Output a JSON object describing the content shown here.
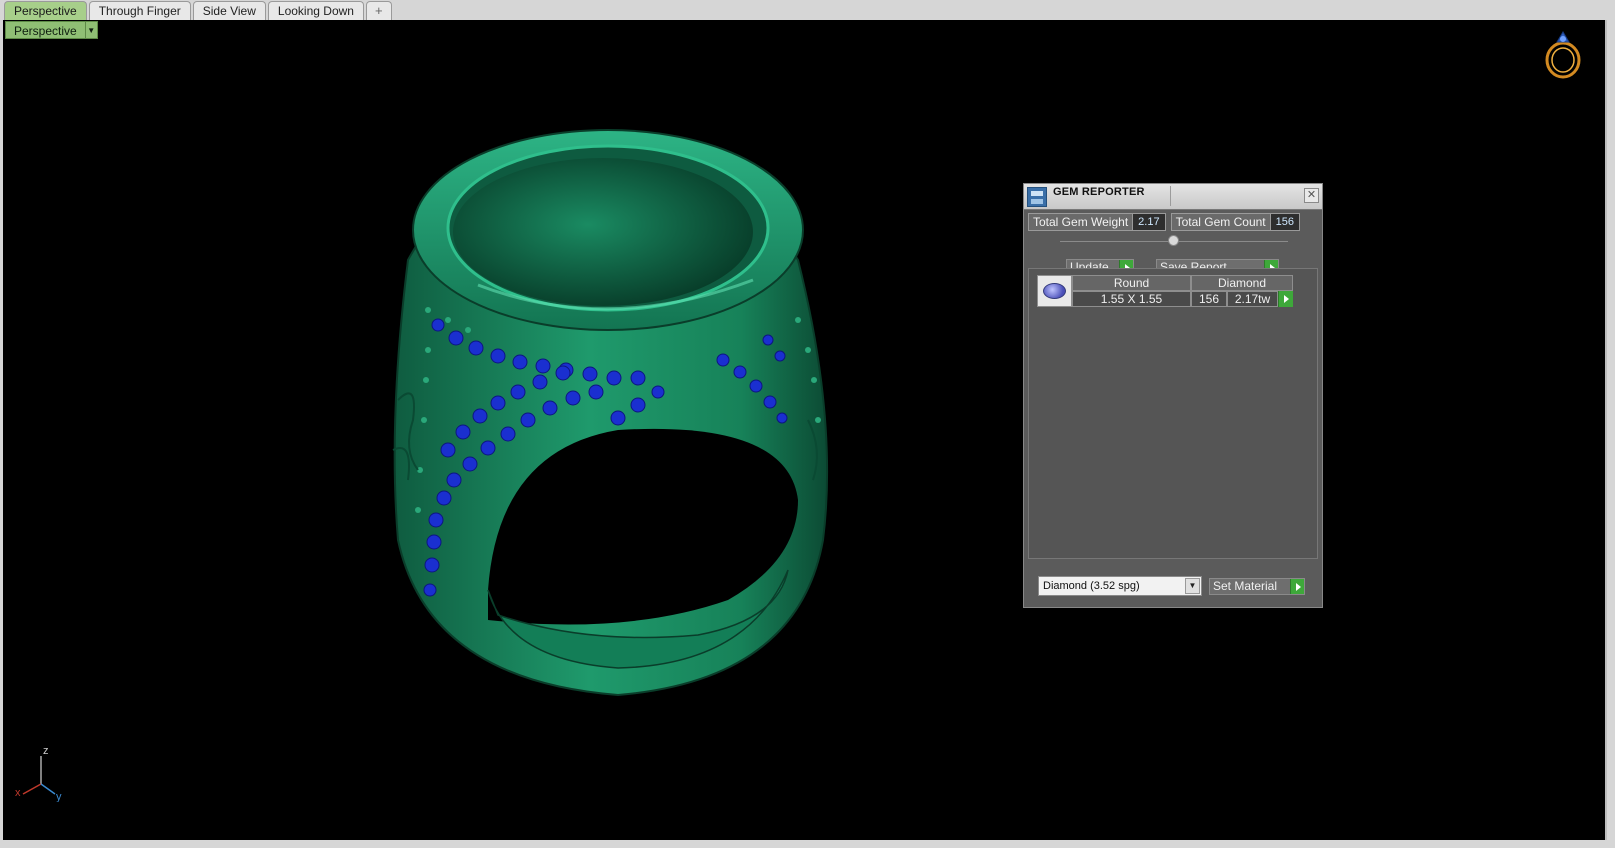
{
  "tabs": [
    {
      "label": "Perspective",
      "active": true
    },
    {
      "label": "Through Finger",
      "active": false
    },
    {
      "label": "Side View",
      "active": false
    },
    {
      "label": "Looking Down",
      "active": false
    },
    {
      "label": "+",
      "active": false
    }
  ],
  "viewport": {
    "view_selector_label": "Perspective",
    "background": "#000000",
    "ring_metal_color": "#1f8a63",
    "gem_color": "#1a2fd0",
    "axis_labels": {
      "z": "z",
      "x": "x",
      "y": "y"
    }
  },
  "gem_reporter": {
    "title": "GEM REPORTER",
    "total_weight_label": "Total Gem Weight",
    "total_weight_value": "2.17",
    "total_count_label": "Total Gem Count",
    "total_count_value": "156",
    "update_label": "Update",
    "save_report_label": "Save Report",
    "gem_rows": [
      {
        "shape": "Round",
        "material": "Diamond",
        "size": "1.55 X 1.55",
        "count": "156",
        "weight": "2.17tw"
      }
    ],
    "material_select_value": "Diamond    (3.52 spg)",
    "set_material_label": "Set Material"
  },
  "colors": {
    "tab_active": "#a7cf8a",
    "accent_green": "#3ea83a",
    "panel_bg": "#5b5b5b"
  }
}
